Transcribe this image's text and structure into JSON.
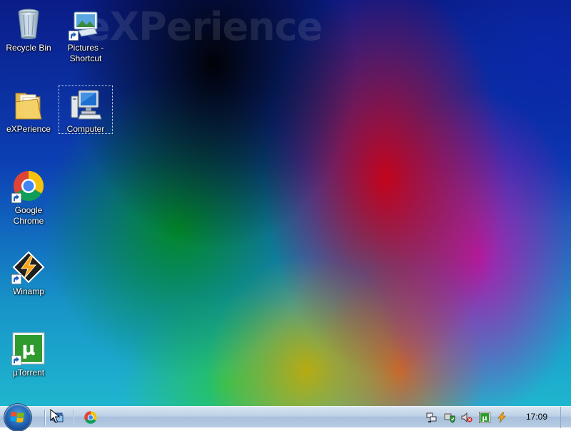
{
  "wallpaper": {
    "watermark": "eXPerience"
  },
  "desktop_icons": [
    {
      "label": "Recycle Bin"
    },
    {
      "label": "Pictures -\nShortcut"
    },
    {
      "label": "eXPerience"
    },
    {
      "label": "Computer",
      "selected": true
    },
    {
      "label": "Google\nChrome"
    },
    {
      "label": "Winamp"
    },
    {
      "label": "µTorrent"
    }
  ],
  "taskbar": {
    "pinned": [
      {
        "icon": "show-desktop-switcher-icon"
      },
      {
        "icon": "chrome-icon"
      }
    ],
    "tray": [
      {
        "icon": "network-icon"
      },
      {
        "icon": "security-shield-icon"
      },
      {
        "icon": "volume-muted-icon"
      },
      {
        "icon": "utorrent-tray-icon"
      },
      {
        "icon": "winamp-agent-icon"
      }
    ],
    "clock": "17:09"
  },
  "colors": {
    "taskbar_top": "#d9e6f3",
    "taskbar_bottom": "#b7cbe3",
    "utorrent_green": "#2f9b2f",
    "chrome_red": "#db4437",
    "chrome_yellow": "#f4c20d",
    "chrome_green": "#0f9d58",
    "chrome_blue": "#4285f4"
  }
}
